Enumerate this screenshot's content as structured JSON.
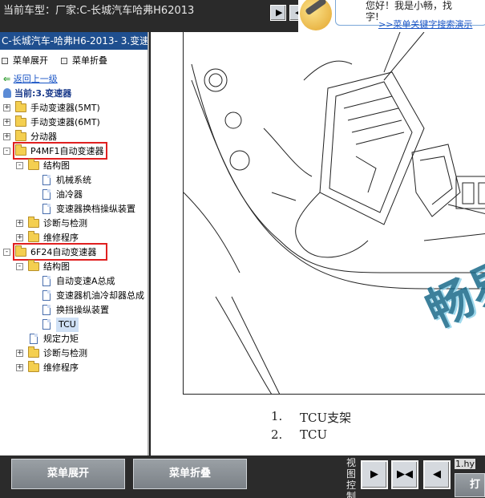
{
  "window": {
    "title": "当前车型：厂家:C-长城汽车哈弗H62013",
    "nav_prev": "◀",
    "nav_next": "▶"
  },
  "ad": {
    "line1": "您好！我是小畅，找",
    "line2": "字!",
    "link": ">>菜单关键字搜索演示"
  },
  "sidebar": {
    "header": "C-长城汽车-哈弗H6-2013- 3.变速器",
    "expand_label": "菜单展开",
    "collapse_label": "菜单折叠",
    "back_label": "返回上一级",
    "current_label": "当前:3.变速器",
    "tree": [
      {
        "label": "手动变速器(5MT)",
        "type": "folder",
        "level": 0,
        "expander": "+"
      },
      {
        "label": "手动变速器(6MT)",
        "type": "folder",
        "level": 0,
        "expander": "+"
      },
      {
        "label": "分动器",
        "type": "folder",
        "level": 0,
        "expander": "+"
      },
      {
        "label": "P4MF1自动变速器",
        "type": "folder",
        "level": 0,
        "expander": "-",
        "highlight": true
      },
      {
        "label": "结构图",
        "type": "folder",
        "level": 1,
        "expander": "-"
      },
      {
        "label": "机械系统",
        "type": "doc",
        "level": 2
      },
      {
        "label": "油冷器",
        "type": "doc",
        "level": 2
      },
      {
        "label": "变速器换档操纵装置",
        "type": "doc",
        "level": 2
      },
      {
        "label": "诊断与检测",
        "type": "folder",
        "level": 1,
        "expander": "+"
      },
      {
        "label": "维修程序",
        "type": "folder",
        "level": 1,
        "expander": "+"
      },
      {
        "label": "6F24自动变速器",
        "type": "folder",
        "level": 0,
        "expander": "-",
        "highlight": true
      },
      {
        "label": "结构图",
        "type": "folder",
        "level": 1,
        "expander": "-"
      },
      {
        "label": "自动变速A总成",
        "type": "doc",
        "level": 2
      },
      {
        "label": "变速器机油冷却器总成",
        "type": "doc",
        "level": 2
      },
      {
        "label": "换挡操纵装置",
        "type": "doc",
        "level": 2
      },
      {
        "label": "TCU",
        "type": "doc",
        "level": 2,
        "selected": true
      },
      {
        "label": "规定力矩",
        "type": "doc",
        "level": 1
      },
      {
        "label": "诊断与检测",
        "type": "folder",
        "level": 1,
        "expander": "+"
      },
      {
        "label": "维修程序",
        "type": "folder",
        "level": 1,
        "expander": "+"
      }
    ]
  },
  "content": {
    "watermark": "畅易",
    "captions": [
      "1.",
      "TCU支架",
      "2.",
      "TCU"
    ]
  },
  "bottom": {
    "expand_button": "菜单展开",
    "collapse_button": "菜单折叠",
    "view_control_label": "视图控制",
    "view_buttons": [
      "▶",
      "▶◀",
      "◀"
    ],
    "file_name": "1.hy",
    "print_label": "打"
  }
}
